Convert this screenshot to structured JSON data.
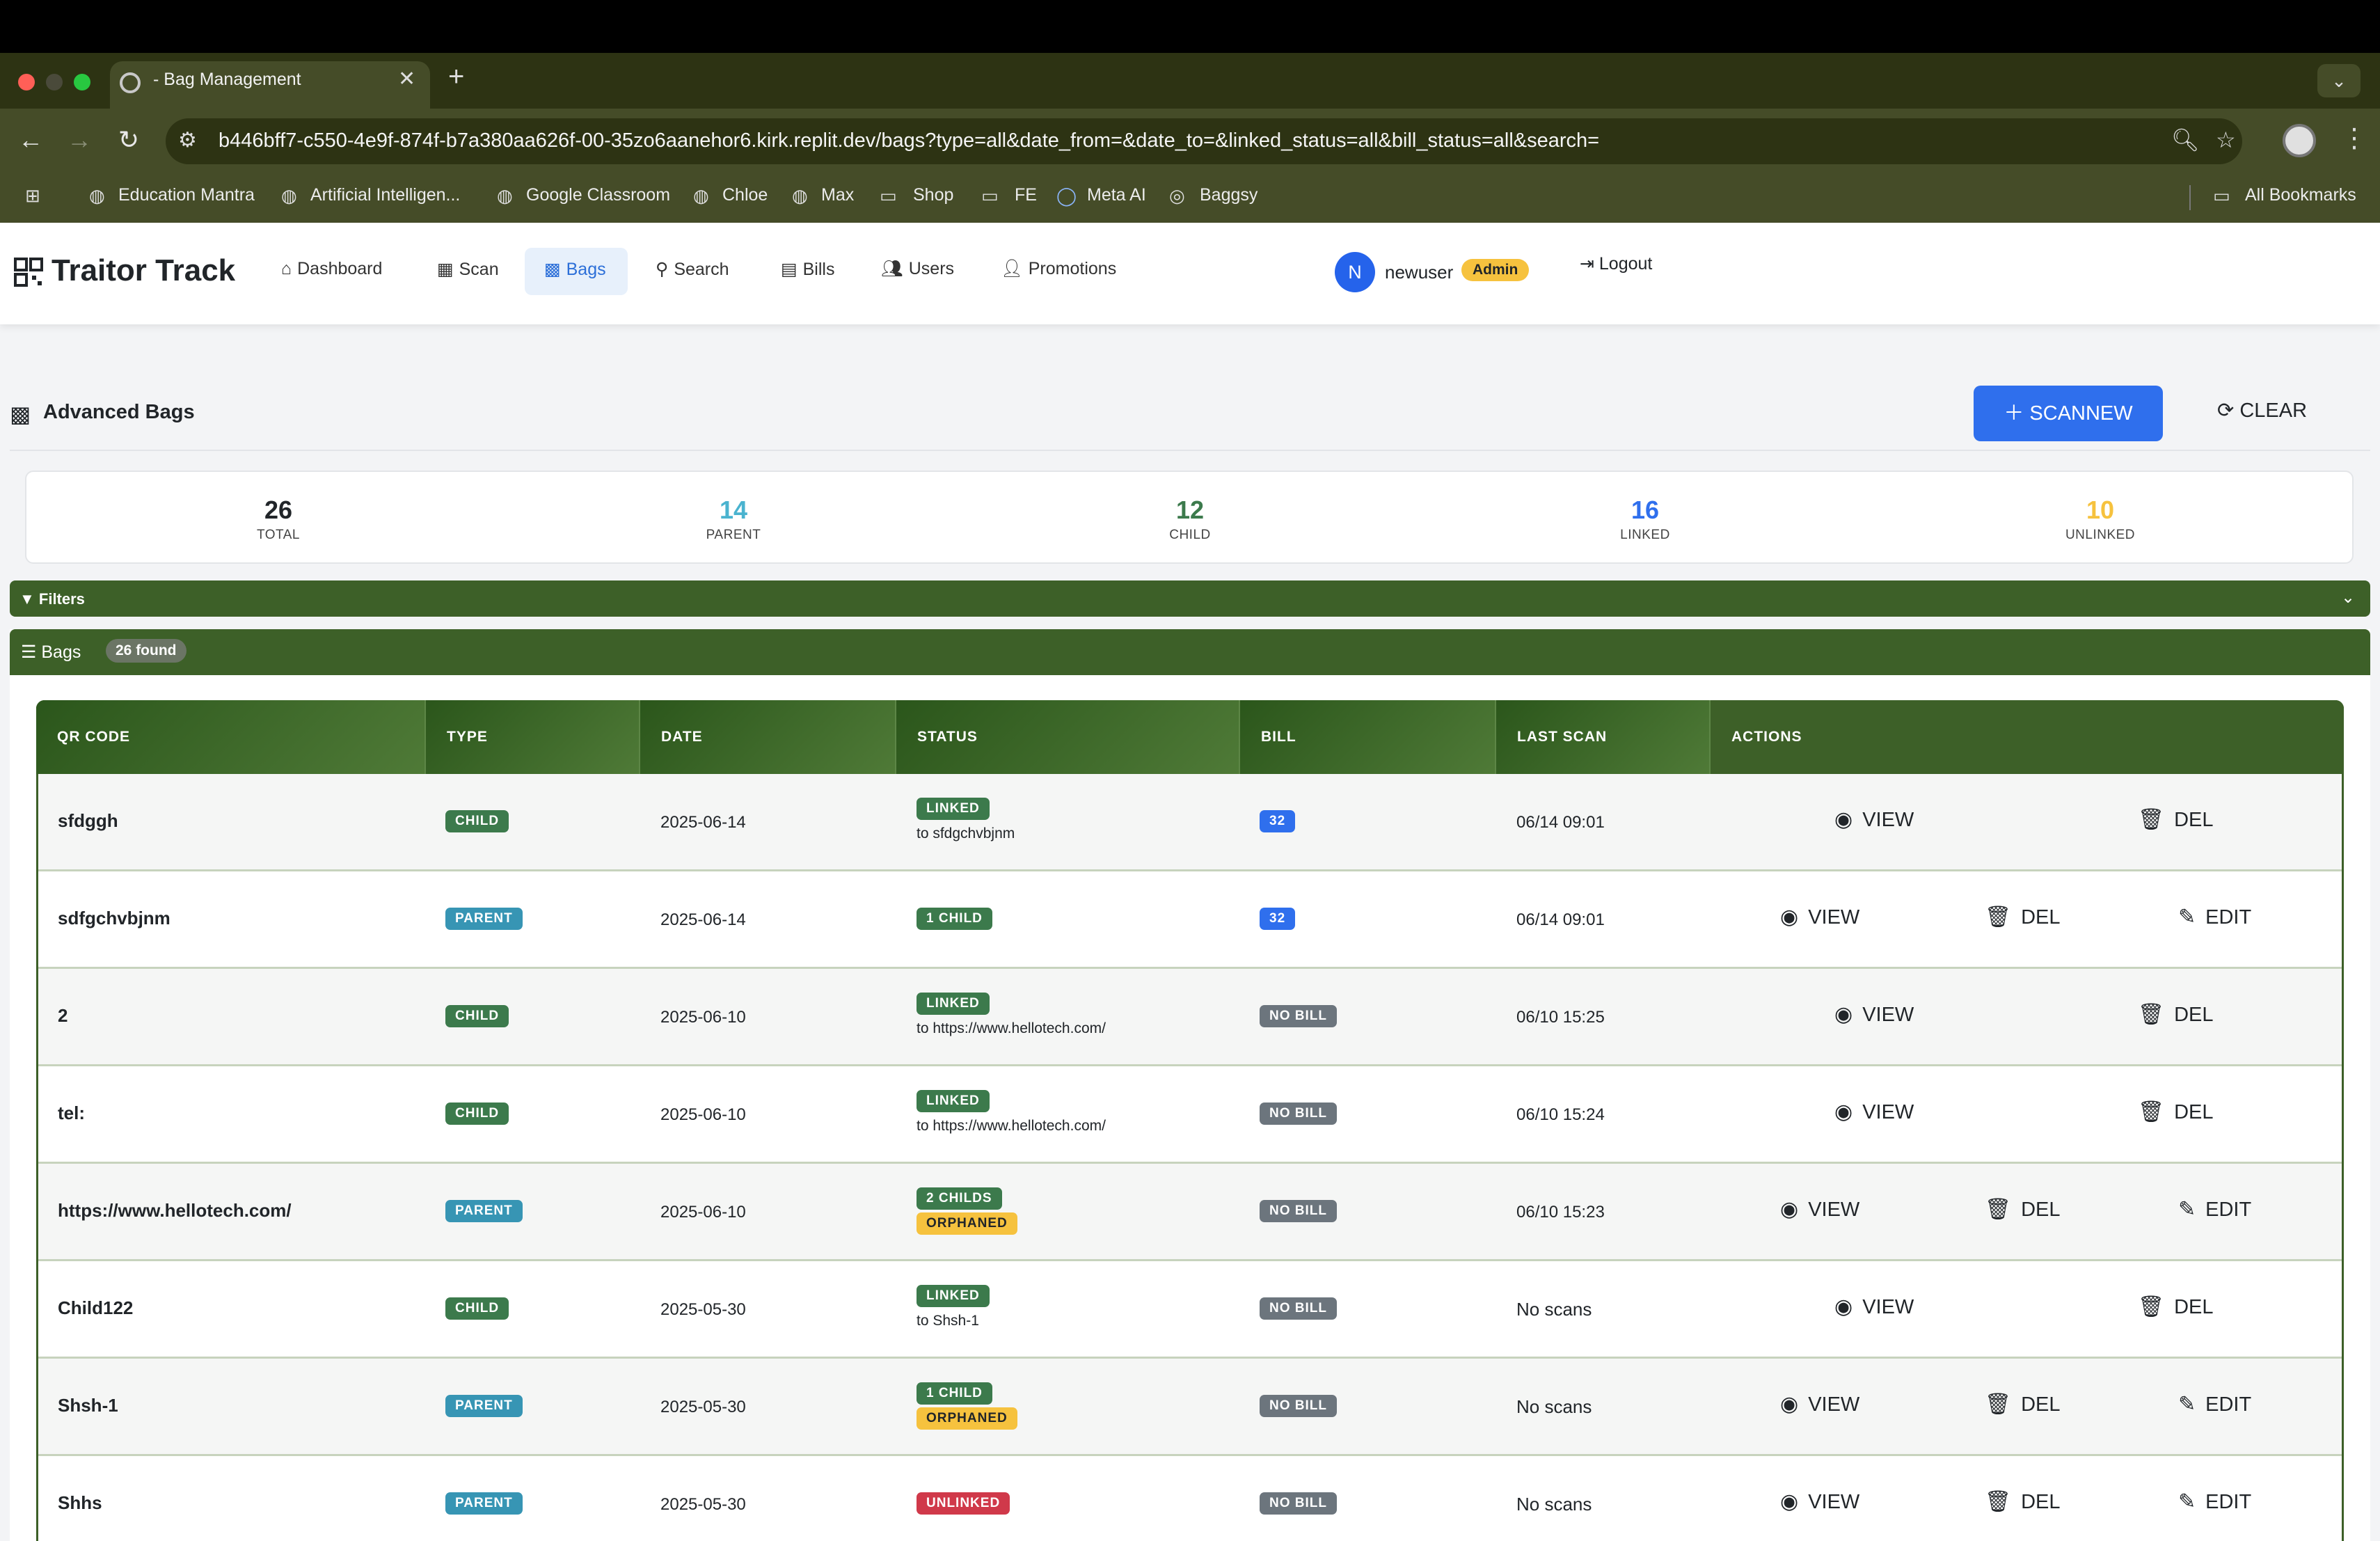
{
  "browser": {
    "tab_title": "- Bag Management",
    "url": "b446bff7-c550-4e9f-874f-b7a380aa626f-00-35zo6aanehor6.kirk.replit.dev/bags?type=all&date_from=&date_to=&linked_status=all&bill_status=all&search=",
    "bookmarks": [
      "Education Mantra",
      "Artificial Intelligen...",
      "Google Classroom",
      "Chloe",
      "Max",
      "Shop",
      "FE",
      "Meta AI",
      "Baggsy"
    ],
    "all_bookmarks": "All Bookmarks"
  },
  "app": {
    "brand": "Traitor Track",
    "nav": [
      "Dashboard",
      "Scan",
      "Bags",
      "Search",
      "Bills",
      "Users",
      "Promotions"
    ],
    "avatar_initial": "N",
    "username": "newuser",
    "role": "Admin",
    "logout": "Logout"
  },
  "page": {
    "title": "Advanced Bags",
    "scannew_label": "SCANNEW",
    "clear_label": "CLEAR"
  },
  "stats": [
    {
      "value": "26",
      "label": "TOTAL",
      "color": "#212529"
    },
    {
      "value": "14",
      "label": "PARENT",
      "color": "#4ab3cf"
    },
    {
      "value": "12",
      "label": "CHILD",
      "color": "#3c7a4c"
    },
    {
      "value": "16",
      "label": "LINKED",
      "color": "#2f6fed"
    },
    {
      "value": "10",
      "label": "UNLINKED",
      "color": "#f6c23e"
    }
  ],
  "filters_label": "Filters",
  "bags": {
    "label": "Bags",
    "found": "26 found",
    "headers": [
      "QR CODE",
      "TYPE",
      "DATE",
      "STATUS",
      "BILL",
      "LAST SCAN",
      "ACTIONS"
    ],
    "actions": {
      "view": "VIEW",
      "del": "DEL",
      "edit": "EDIT"
    },
    "rows": [
      {
        "qr": "sfdggh",
        "type": "CHILD",
        "date": "2025-06-14",
        "status1": "LINKED",
        "status2": "",
        "sub": "to sfdgchvbjnm",
        "bill": "32",
        "last_scan": "06/14 09:01"
      },
      {
        "qr": "sdfgchvbjnm",
        "type": "PARENT",
        "date": "2025-06-14",
        "status1": "1 CHILD",
        "status2": "",
        "sub": "",
        "bill": "32",
        "last_scan": "06/14 09:01"
      },
      {
        "qr": "2",
        "type": "CHILD",
        "date": "2025-06-10",
        "status1": "LINKED",
        "status2": "",
        "sub": "to https://www.hellotech.com/",
        "bill": "NO BILL",
        "last_scan": "06/10 15:25"
      },
      {
        "qr": "tel:",
        "type": "CHILD",
        "date": "2025-06-10",
        "status1": "LINKED",
        "status2": "",
        "sub": "to https://www.hellotech.com/",
        "bill": "NO BILL",
        "last_scan": "06/10 15:24"
      },
      {
        "qr": "https://www.hellotech.com/",
        "type": "PARENT",
        "date": "2025-06-10",
        "status1": "2 CHILDS",
        "status2": "ORPHANED",
        "sub": "",
        "bill": "NO BILL",
        "last_scan": "06/10 15:23"
      },
      {
        "qr": "Child122",
        "type": "CHILD",
        "date": "2025-05-30",
        "status1": "LINKED",
        "status2": "",
        "sub": "to Shsh-1",
        "bill": "NO BILL",
        "last_scan": "No scans"
      },
      {
        "qr": "Shsh-1",
        "type": "PARENT",
        "date": "2025-05-30",
        "status1": "1 CHILD",
        "status2": "ORPHANED",
        "sub": "",
        "bill": "NO BILL",
        "last_scan": "No scans"
      },
      {
        "qr": "Shhs",
        "type": "PARENT",
        "date": "2025-05-30",
        "status1": "UNLINKED",
        "status2": "",
        "sub": "",
        "bill": "NO BILL",
        "last_scan": "No scans"
      }
    ]
  }
}
